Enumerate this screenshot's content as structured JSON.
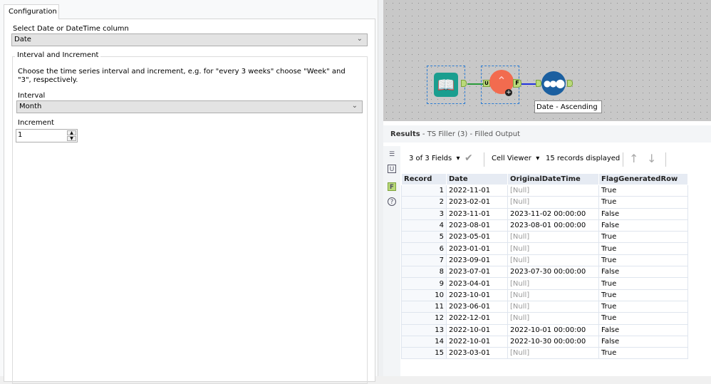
{
  "config": {
    "tab": "Configuration",
    "date_col_label": "Select Date or DateTime column",
    "date_col_value": "Date",
    "group_title": "Interval and Increment",
    "description": "Choose the time series interval and increment, e.g. for \"every 3 weeks\" choose \"Week\" and \"3\", respectively.",
    "interval_label": "Interval",
    "interval_value": "Month",
    "increment_label": "Increment",
    "increment_value": "1"
  },
  "canvas": {
    "tool_annotation": "Date - Ascending",
    "anchor_u": "U",
    "anchor_f": "F",
    "colors": {
      "input": "#1a9e8f",
      "filler": "#f26b4f",
      "sort": "#1b5fa0"
    }
  },
  "results": {
    "title": "Results",
    "subtitle": "- TS Filler (3) - Filled Output",
    "fields": "3 of 3 Fields",
    "viewer": "Cell Viewer",
    "records": "15 records displayed",
    "columns": [
      "Record",
      "Date",
      "OriginalDateTime",
      "FlagGeneratedRow"
    ],
    "rows": [
      [
        "1",
        "2022-11-01",
        "[Null]",
        "True"
      ],
      [
        "2",
        "2023-02-01",
        "[Null]",
        "True"
      ],
      [
        "3",
        "2023-11-01",
        "2023-11-02 00:00:00",
        "False"
      ],
      [
        "4",
        "2023-08-01",
        "2023-08-01 00:00:00",
        "False"
      ],
      [
        "5",
        "2023-05-01",
        "[Null]",
        "True"
      ],
      [
        "6",
        "2023-01-01",
        "[Null]",
        "True"
      ],
      [
        "7",
        "2023-09-01",
        "[Null]",
        "True"
      ],
      [
        "8",
        "2023-07-01",
        "2023-07-30 00:00:00",
        "False"
      ],
      [
        "9",
        "2023-04-01",
        "[Null]",
        "True"
      ],
      [
        "10",
        "2023-10-01",
        "[Null]",
        "True"
      ],
      [
        "11",
        "2023-06-01",
        "[Null]",
        "True"
      ],
      [
        "12",
        "2022-12-01",
        "[Null]",
        "True"
      ],
      [
        "13",
        "2022-10-01",
        "2022-10-01 00:00:00",
        "False"
      ],
      [
        "14",
        "2022-10-01",
        "2022-10-30 00:00:00",
        "False"
      ],
      [
        "15",
        "2023-03-01",
        "[Null]",
        "True"
      ]
    ]
  }
}
